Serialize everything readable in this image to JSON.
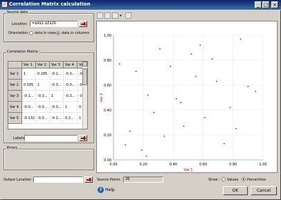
{
  "window": {
    "title": "Correlation Matrix calculation",
    "minimize_glyph": "_",
    "maximize_glyph": "□",
    "close_glyph": "×"
  },
  "source_data": {
    "group_label": "Source data",
    "location_label": "Location:",
    "location_value": "=$A$1:$Z$26",
    "orientation_label": "Orientation:",
    "orientation_rows": "data in rows",
    "orientation_columns": "data in columns",
    "orientation_selected": "columns"
  },
  "matrix": {
    "group_label": "Correlation Matrix :",
    "column_headers": [
      "",
      "Var 1",
      "Var 2",
      "Var 3",
      "Var 4",
      "Var 5"
    ],
    "rows": [
      [
        "Var 1",
        "1",
        "0.185",
        "-0.1...",
        "-0.0...",
        "-0.1..."
      ],
      [
        "Var 2",
        "0.185",
        "1",
        "-0.3...",
        "-0.0...",
        "-0.1..."
      ],
      [
        "Var 3",
        "-0.1...",
        "-0.3...",
        "1",
        "-0.3...",
        "-0.0..."
      ],
      [
        "Var 4",
        "-0.0...",
        "-0.0...",
        "-0.3...",
        "1",
        "0.2..."
      ],
      [
        "Var 5",
        "-0.132",
        "-0.0...",
        "-0.1...",
        "0.2...",
        "1"
      ]
    ],
    "labels_label": "Labels :",
    "labels_value": ""
  },
  "errors": {
    "group_label": "Errors"
  },
  "output": {
    "label": "Output Location :",
    "value": ""
  },
  "source_points": {
    "label": "Source Points :",
    "value": "26"
  },
  "show": {
    "label": "Show :",
    "values_label": "Values",
    "percentiles_label": "Percentiles",
    "selected": "percentiles"
  },
  "buttons": {
    "help": "Help",
    "ok": "OK",
    "cancel": "Cancel"
  },
  "toolbar": {
    "icons": [
      "copy-icon",
      "print-icon",
      "edit-brush-icon",
      "dropdown-arrow-icon",
      "zoom-icon"
    ]
  },
  "colors": {
    "title_bar": "#0a246a",
    "point_color": "#e00000",
    "axis_label_color": "#e00000"
  },
  "chart_data": {
    "type": "scatter",
    "title": "",
    "xlabel": "Var 1",
    "ylabel": "Var 2",
    "xlim": [
      0,
      1
    ],
    "ylim": [
      0,
      1
    ],
    "xticks": [
      "0.00",
      "0.20",
      "0.40",
      "0.60",
      "0.80",
      "1.00"
    ],
    "yticks": [
      "0.00",
      "0.20",
      "0.40",
      "0.60",
      "0.80",
      "1.00"
    ],
    "grid": true,
    "series": [
      {
        "x": [
          0.04,
          0.08,
          0.11,
          0.15,
          0.19,
          0.22,
          0.23,
          0.27,
          0.31,
          0.34,
          0.38,
          0.42,
          0.45,
          0.47,
          0.52,
          0.55,
          0.58,
          0.61,
          0.66,
          0.69,
          0.74,
          0.78,
          0.82,
          0.85,
          0.9,
          0.95
        ],
        "y": [
          0.77,
          0.12,
          0.23,
          0.71,
          0.08,
          0.03,
          0.52,
          0.38,
          0.89,
          0.19,
          0.75,
          0.49,
          0.46,
          0.27,
          0.85,
          0.67,
          0.92,
          0.34,
          0.81,
          0.63,
          0.13,
          0.42,
          0.25,
          0.97,
          0.59,
          0.55
        ]
      }
    ]
  }
}
